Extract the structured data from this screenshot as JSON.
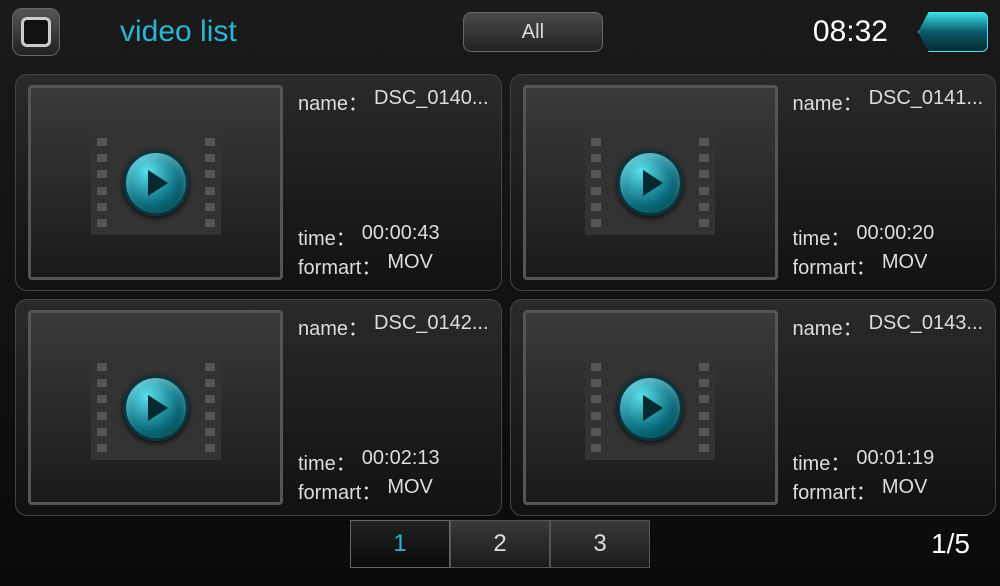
{
  "header": {
    "title": "video list",
    "all_button": "All",
    "clock": "08:32"
  },
  "labels": {
    "name": "name：",
    "time": "time：",
    "format": "formart："
  },
  "videos": [
    {
      "name": "DSC_0140...",
      "time": "00:00:43",
      "format": "MOV"
    },
    {
      "name": "DSC_0141...",
      "time": "00:00:20",
      "format": "MOV"
    },
    {
      "name": "DSC_0142...",
      "time": "00:02:13",
      "format": "MOV"
    },
    {
      "name": "DSC_0143...",
      "time": "00:01:19",
      "format": "MOV"
    }
  ],
  "pager": {
    "pages": [
      "1",
      "2",
      "3"
    ],
    "active_index": 0,
    "label": "1/5"
  }
}
